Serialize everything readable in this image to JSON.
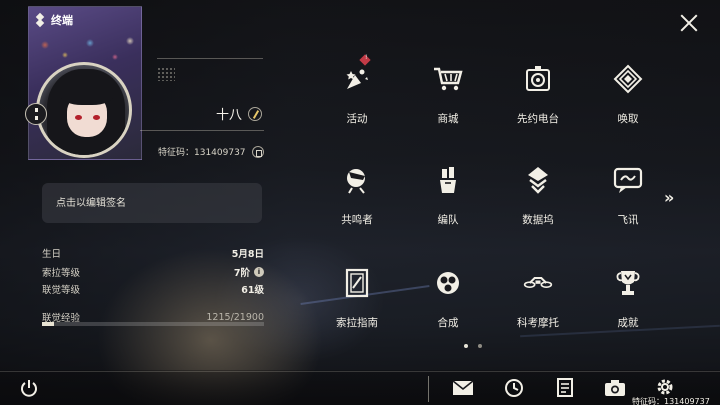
{
  "profile": {
    "card_title": "终端",
    "player_name": "十八",
    "player_id": "特征码：131409737",
    "signature_placeholder": "点击以编辑签名"
  },
  "stats": [
    {
      "label": "生日",
      "value": "5月8日"
    },
    {
      "label": "索拉等级",
      "value": "7阶"
    },
    {
      "label": "联觉等级",
      "value": "61级"
    },
    {
      "label": "联觉经验",
      "value": "1215/21900"
    }
  ],
  "exp_progress": 0.0555,
  "menu": [
    {
      "label": "活动",
      "icon": "event-icon",
      "badge": "!"
    },
    {
      "label": "商城",
      "icon": "shop-cart-icon"
    },
    {
      "label": "先约电台",
      "icon": "radio-icon"
    },
    {
      "label": "唤取",
      "icon": "convene-icon"
    },
    {
      "label": "共鸣者",
      "icon": "resonator-icon"
    },
    {
      "label": "编队",
      "icon": "team-icon"
    },
    {
      "label": "数据坞",
      "icon": "data-bank-icon"
    },
    {
      "label": "飞讯",
      "icon": "message-icon"
    },
    {
      "label": "索拉指南",
      "icon": "guidebook-icon"
    },
    {
      "label": "合成",
      "icon": "synthesis-icon"
    },
    {
      "label": "科考摩托",
      "icon": "motorcycle-icon"
    },
    {
      "label": "成就",
      "icon": "trophy-icon"
    }
  ],
  "pagination": {
    "pages": 2,
    "current": 1
  },
  "bottom_bar": {
    "icons": [
      "power-icon",
      "mail-icon",
      "clock-icon",
      "notes-icon",
      "camera-icon",
      "settings-icon"
    ],
    "footer_id": "特征码：131409737"
  },
  "colors": {
    "accent": "#f2efe6",
    "badge": "#c23a46",
    "panel": "#3c3e46"
  }
}
